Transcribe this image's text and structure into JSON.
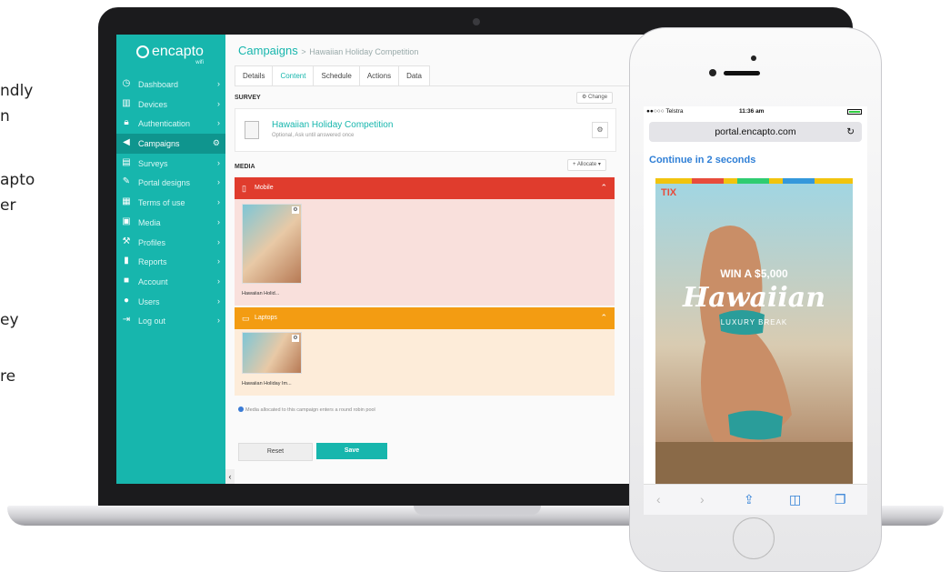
{
  "side_text": [
    "ndly",
    "n",
    "apto",
    "er",
    "ey",
    "re"
  ],
  "laptop": {
    "app": {
      "logo": "encapto",
      "logo_sub": "wifi",
      "nav": [
        {
          "icon": "dashboard-icon",
          "glyph": "◷",
          "label": "Dashboard",
          "active": false
        },
        {
          "icon": "devices-icon",
          "glyph": "▥",
          "label": "Devices",
          "active": false
        },
        {
          "icon": "lock-icon",
          "glyph": "🔒︎",
          "label": "Authentication",
          "active": false
        },
        {
          "icon": "megaphone-icon",
          "glyph": "◀",
          "label": "Campaigns",
          "active": true
        },
        {
          "icon": "survey-icon",
          "glyph": "▤",
          "label": "Surveys",
          "active": false
        },
        {
          "icon": "pencil-icon",
          "glyph": "✎",
          "label": "Portal designs",
          "active": false
        },
        {
          "icon": "document-icon",
          "glyph": "▦",
          "label": "Terms of use",
          "active": false
        },
        {
          "icon": "media-icon",
          "glyph": "▣",
          "label": "Media",
          "active": false
        },
        {
          "icon": "wrench-icon",
          "glyph": "⚒",
          "label": "Profiles",
          "active": false
        },
        {
          "icon": "bar-chart-icon",
          "glyph": "▮",
          "label": "Reports",
          "active": false
        },
        {
          "icon": "briefcase-icon",
          "glyph": "■",
          "label": "Account",
          "active": false
        },
        {
          "icon": "user-icon",
          "glyph": "●",
          "label": "Users",
          "active": false
        },
        {
          "icon": "logout-icon",
          "glyph": "⇥",
          "label": "Log out",
          "active": false
        }
      ],
      "breadcrumb": {
        "root": "Campaigns",
        "separator": ">",
        "current": "Hawaiian Holiday Competition"
      },
      "tabs": [
        {
          "label": "Details",
          "active": false
        },
        {
          "label": "Content",
          "active": true
        },
        {
          "label": "Schedule",
          "active": false
        },
        {
          "label": "Actions",
          "active": false
        },
        {
          "label": "Data",
          "active": false
        }
      ],
      "survey": {
        "section_title": "SURVEY",
        "change_label": "⚙ Change",
        "name": "Hawaiian Holiday Competition",
        "subtitle": "Optional, Ask until answered once"
      },
      "media": {
        "section_title": "MEDIA",
        "allocate_label": "+ Allocate ▾",
        "mobile_label": "Mobile",
        "mobile_caption": "Hawaiian Holid...",
        "laptop_label": "Laptops",
        "laptop_caption": "Hawaiian Holiday Im...",
        "info_text": "Media allocated to this campaign enters a round robin pool"
      },
      "buttons": {
        "reset": "Reset",
        "save": "Save"
      },
      "colors": {
        "accent": "#17b6ad",
        "mobile_band": "#e03c2d",
        "laptop_band": "#f39c12"
      }
    }
  },
  "phone": {
    "status": {
      "carrier": "●●○○○ Telstra",
      "time": "11:36 am"
    },
    "url": "portal.encapto.com",
    "continue_text": "Continue in 2 seconds",
    "ad": {
      "brand": "TIX",
      "headline": "WIN A $5,000",
      "title": "Hawaiian",
      "subtitle": "LUXURY BREAK"
    }
  }
}
